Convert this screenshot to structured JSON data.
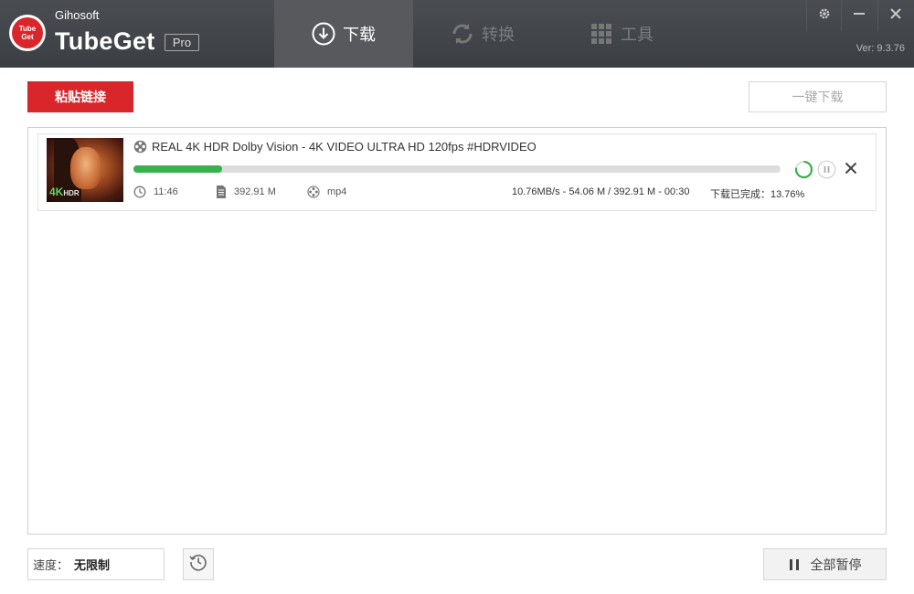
{
  "app": {
    "brand_small": "Gihosoft",
    "brand_name": "TubeGet",
    "edition": "Pro",
    "logo_text_top": "Tube",
    "logo_text_bottom": "Get",
    "version": "Ver: 9.3.76"
  },
  "tabs": [
    {
      "label": "下载",
      "icon": "download-circle-icon",
      "active": true
    },
    {
      "label": "转换",
      "icon": "convert-cycle-icon",
      "active": false
    },
    {
      "label": "工具",
      "icon": "grid-tools-icon",
      "active": false
    }
  ],
  "window_controls": [
    "settings-gear-icon",
    "minimize-icon",
    "close-icon"
  ],
  "toolbar": {
    "paste_label": "粘贴链接",
    "oneclick_label": "一键下载"
  },
  "downloads": [
    {
      "title": "REAL 4K HDR Dolby Vision - 4K VIDEO ULTRA HD 120fps #HDRVIDEO",
      "duration": "11:46",
      "size": "392.91 M",
      "format": "mp4",
      "progress_text": "10.76MB/s - 54.06 M / 392.91 M - 00:30",
      "status_text": "下载已完成：13.76%",
      "progress_fraction": 0.1376,
      "thumb_badge": "4K",
      "thumb_badge_small": "HDR"
    }
  ],
  "footer": {
    "speed_label": "速度：",
    "speed_value": "无限制",
    "pause_all_label": "全部暂停"
  },
  "colors": {
    "accent": "#d8262b",
    "titlebar": "#3f4246",
    "progress": "#37b24d"
  }
}
